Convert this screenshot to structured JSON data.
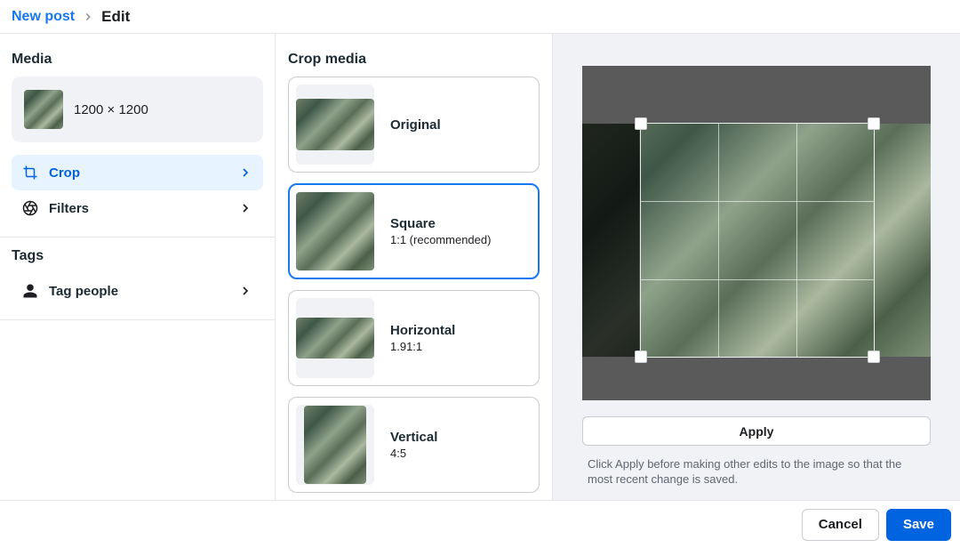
{
  "breadcrumb": {
    "parent": "New post",
    "current": "Edit"
  },
  "sidebar": {
    "media_title": "Media",
    "media_dimensions": "1200 × 1200",
    "items": [
      {
        "label": "Crop",
        "active": true
      },
      {
        "label": "Filters",
        "active": false
      }
    ],
    "tags_title": "Tags",
    "tag_people_label": "Tag people"
  },
  "crop": {
    "title": "Crop media",
    "options": [
      {
        "label": "Original",
        "sub": ""
      },
      {
        "label": "Square",
        "sub": "1:1 (recommended)"
      },
      {
        "label": "Horizontal",
        "sub": "1.91:1"
      },
      {
        "label": "Vertical",
        "sub": "4:5"
      }
    ],
    "apply_label": "Apply",
    "helper_text": "Click Apply before making other edits to the image so that the most recent change is saved."
  },
  "footer": {
    "cancel_label": "Cancel",
    "save_label": "Save"
  }
}
